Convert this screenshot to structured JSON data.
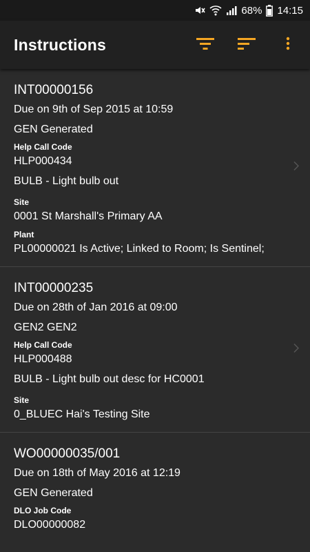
{
  "status_bar": {
    "battery_percent": "68%",
    "time": "14:15",
    "icons": [
      "mute-icon",
      "wifi-icon",
      "signal-icon",
      "battery-icon"
    ]
  },
  "app_bar": {
    "title": "Instructions",
    "actions": [
      "filter-icon",
      "sort-icon",
      "more-vert-icon"
    ],
    "accent_color": "#f5a623"
  },
  "cards": [
    {
      "id": "INT00000156",
      "due": "Due on 9th of Sep 2015 at 10:59",
      "type": "GEN Generated",
      "code_label": "Help Call Code",
      "code_value": "HLP000434",
      "code_desc": "BULB - Light bulb out",
      "site_label": "Site",
      "site_value": "0001 St Marshall's Primary AA",
      "plant_label": "Plant",
      "plant_value": "PL00000021 Is Active; Linked to Room; Is Sentinel;"
    },
    {
      "id": "INT00000235",
      "due": "Due on 28th of Jan 2016 at 09:00",
      "type": "GEN2 GEN2",
      "code_label": "Help Call Code",
      "code_value": "HLP000488",
      "code_desc": "BULB - Light bulb out desc for HC0001",
      "site_label": "Site",
      "site_value": "0_BLUEC Hai's Testing Site"
    },
    {
      "id": "WO00000035/001",
      "due": "Due on 18th of May 2016 at 12:19",
      "type": "GEN Generated",
      "code_label": "DLO Job Code",
      "code_value": "DLO00000082"
    }
  ]
}
